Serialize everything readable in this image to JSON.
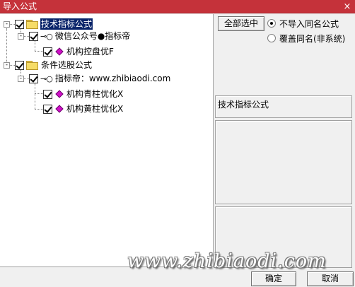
{
  "window": {
    "title": "导入公式",
    "close": "×"
  },
  "tree": {
    "groups": [
      {
        "label": "技术指标公式",
        "expander": "-",
        "author": "微信公众号●指标帝",
        "formulas": [
          "机构控盘优F"
        ]
      },
      {
        "label": "条件选股公式",
        "expander": "-",
        "author": "指标帝：www.zhibiaodi.com",
        "formulas": [
          "机构青柱优化X",
          "机构黄柱优化X"
        ]
      }
    ]
  },
  "options": {
    "select_all_label": "全部选中",
    "radio_skip_label": "不导入同名公式",
    "radio_overwrite_label": "覆盖同名(非系统)",
    "selected": "skip"
  },
  "info": {
    "type_label": "技术指标公式"
  },
  "watermark": "www.zhibiaodi.com",
  "buttons": {
    "ok": "确定",
    "cancel": "取消"
  }
}
